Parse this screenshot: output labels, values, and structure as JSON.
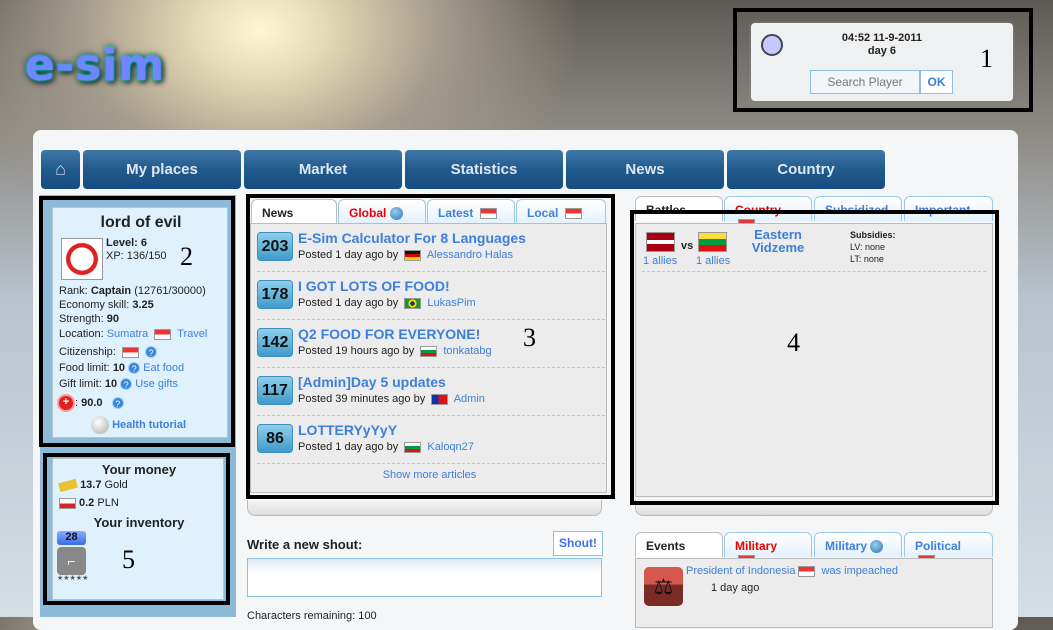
{
  "logo": "e-sim",
  "clock": {
    "time": "04:52 11-9-2011",
    "day": "day 6",
    "search_placeholder": "Search Player",
    "ok": "OK"
  },
  "nav": [
    "My places",
    "Market",
    "Statistics",
    "News",
    "Country"
  ],
  "profile": {
    "name": "lord of evil",
    "level_label": "Level:",
    "level": "6",
    "xp": "XP: 136/150",
    "rank_label": "Rank:",
    "rank": "Captain",
    "rank_progress": "(12761/30000)",
    "eco_label": "Economy skill:",
    "eco": "3.25",
    "str_label": "Strength:",
    "str": "90",
    "loc_label": "Location:",
    "location": "Sumatra",
    "travel": "Travel",
    "citizenship": "Citizenship:",
    "food_label": "Food limit:",
    "food": "10",
    "eat": "Eat food",
    "gift_label": "Gift limit:",
    "gift": "10",
    "use_gifts": "Use gifts",
    "health": "90.0",
    "health_tutorial": "Health tutorial"
  },
  "money": {
    "title": "Your money",
    "gold": "13.7",
    "gold_unit": "Gold",
    "pln": "0.2",
    "pln_unit": "PLN",
    "inv_title": "Your inventory",
    "inv_count": "28",
    "inv_stars": "★★★★★"
  },
  "news": {
    "tabs": [
      "News",
      "Global",
      "Latest",
      "Local"
    ],
    "articles": [
      {
        "votes": "203",
        "title": "E-Sim Calculator For 8 Languages",
        "posted": "Posted 1 day ago by",
        "author": "Alessandro Halas",
        "flag": "de"
      },
      {
        "votes": "178",
        "title": "I GOT LOTS OF FOOD!",
        "posted": "Posted 1 day ago by",
        "author": "LukasPim",
        "flag": "br"
      },
      {
        "votes": "142",
        "title": "Q2 FOOD FOR EVERYONE!",
        "posted": "Posted 19 hours ago by",
        "author": "tonkatabg",
        "flag": "bg"
      },
      {
        "votes": "117",
        "title": "[Admin]Day 5 updates",
        "posted": "Posted 39 minutes ago by",
        "author": "Admin",
        "flag": "tw"
      },
      {
        "votes": "86",
        "title": "LOTTERYyYyY",
        "posted": "Posted 1 day ago by",
        "author": "Kaloqn27",
        "flag": "bg"
      }
    ],
    "more": "Show more articles"
  },
  "battles": {
    "tabs": [
      "Battles",
      "Country",
      "Subsidized",
      "Important"
    ],
    "allies1": "1 allies",
    "vs": "vs",
    "allies2": "1 allies",
    "region": "Eastern Vidzeme",
    "subsidies": "Subsidies:",
    "lv": "LV: none",
    "lt": "LT: none"
  },
  "shout": {
    "label": "Write a new shout:",
    "button": "Shout!",
    "remaining": "Characters remaining: 100"
  },
  "events": {
    "tabs": [
      "Events",
      "Military",
      "Military",
      "Political"
    ],
    "item_link": "President of Indonesia",
    "item_text": "was impeached",
    "time": "1 day ago"
  },
  "annotations": [
    "1",
    "2",
    "3",
    "4",
    "5"
  ]
}
